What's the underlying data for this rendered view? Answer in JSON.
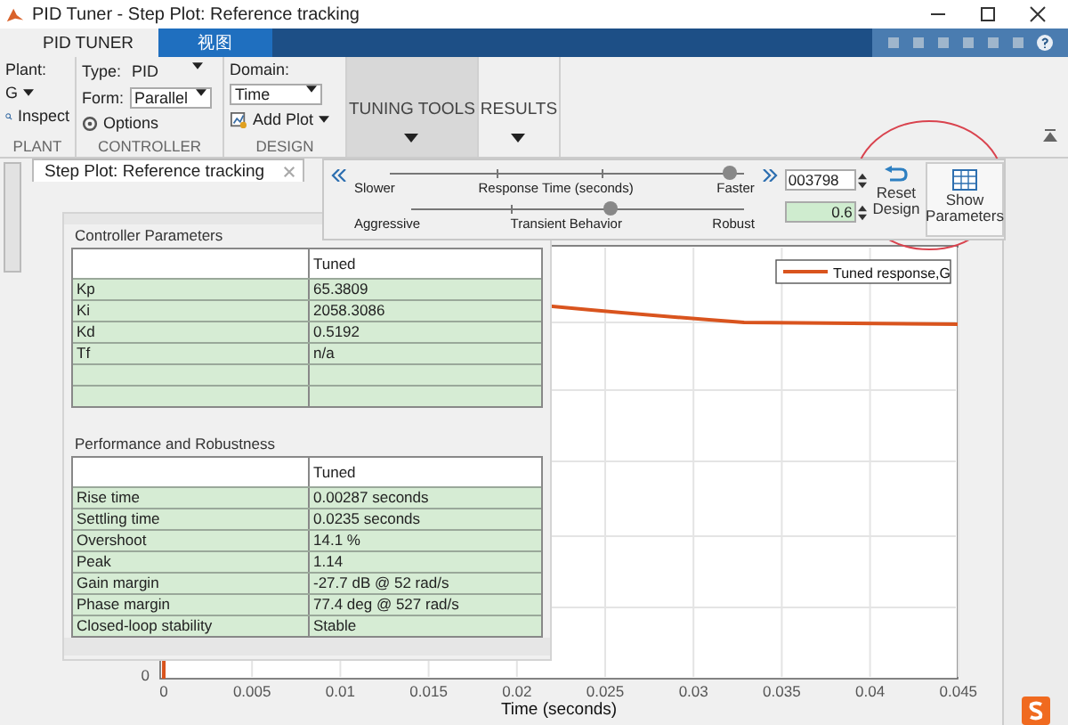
{
  "window": {
    "title": "PID Tuner - Step Plot: Reference tracking"
  },
  "ribbon_tabs": [
    {
      "label": "PID TUNER",
      "selected": true
    },
    {
      "label": "视图",
      "selected": false
    }
  ],
  "toolstrip": {
    "plant": {
      "label": "Plant:",
      "value": "G",
      "inspect": "Inspect",
      "section": "PLANT"
    },
    "controller": {
      "type_label": "Type:",
      "type_value": "PID",
      "form_label": "Form:",
      "form_value": "Parallel",
      "options": "Options",
      "section": "CONTROLLER"
    },
    "design": {
      "domain_label": "Domain:",
      "domain_value": "Time",
      "add_plot": "Add Plot",
      "section": "DESIGN"
    },
    "tuning_tools": {
      "label": "TUNING TOOLS",
      "selected": true
    },
    "results": {
      "label": "RESULTS",
      "selected": false
    }
  },
  "document_tab": {
    "label": "Step Plot: Reference tracking"
  },
  "tuning_panel": {
    "sliders": [
      {
        "left": "Slower",
        "center": "Response Time (seconds)",
        "right": "Faster",
        "level": 0.96,
        "value": "003798"
      },
      {
        "left": "Aggressive",
        "center": "Transient Behavior",
        "right": "Robust",
        "level": 0.6,
        "value": "0.6"
      }
    ],
    "reset_button": "Reset Design",
    "show_button": "Show Parameters"
  },
  "controller_parameters": {
    "title": "Controller Parameters",
    "column": "Tuned",
    "rows": [
      {
        "name": "Kp",
        "value": "65.3809"
      },
      {
        "name": "Ki",
        "value": "2058.3086"
      },
      {
        "name": "Kd",
        "value": "0.5192"
      },
      {
        "name": "Tf",
        "value": "n/a"
      }
    ]
  },
  "performance": {
    "title": "Performance and Robustness",
    "column": "Tuned",
    "rows": [
      {
        "name": "Rise time",
        "value": "0.00287 seconds"
      },
      {
        "name": "Settling time",
        "value": "0.0235 seconds"
      },
      {
        "name": "Overshoot",
        "value": "14.1 %"
      },
      {
        "name": "Peak",
        "value": "1.14"
      },
      {
        "name": "Gain margin",
        "value": "-27.7 dB @ 52 rad/s"
      },
      {
        "name": "Phase margin",
        "value": "77.4 deg @ 527 rad/s"
      },
      {
        "name": "Closed-loop stability",
        "value": "Stable"
      }
    ]
  },
  "plot": {
    "legend": "Tuned response,G",
    "y_tick": "0",
    "x_ticks": [
      "0",
      "0.005",
      "0.01",
      "0.015",
      "0.02",
      "0.025",
      "0.03",
      "0.035",
      "0.04",
      "0.045"
    ],
    "xlabel": "Time (seconds)"
  }
}
